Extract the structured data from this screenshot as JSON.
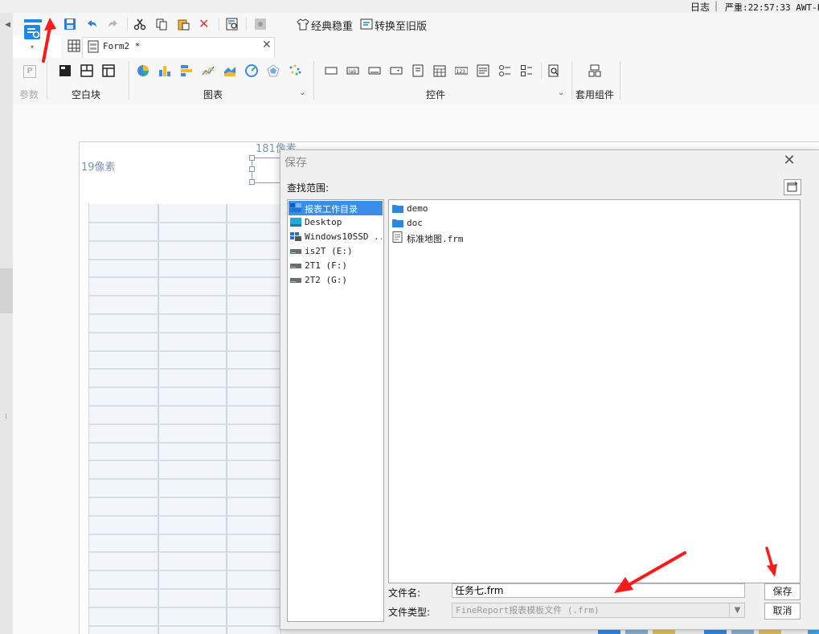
{
  "status_bar": {
    "log_label": "日志",
    "severity_text": "严重:22:57:33 AWT-Ev"
  },
  "toolbar": {
    "classic_stable_label": "经典稳重",
    "convert_old_label": "转换至旧版"
  },
  "tab": {
    "form_name": "Form2 *"
  },
  "ribbon": {
    "params_label": "参数",
    "blank_block_label": "空白块",
    "chart_label": "图表",
    "controls_label": "控件",
    "package_label": "套用组件"
  },
  "canvas": {
    "left_pixel_label": "19像素",
    "top_pixel_label": "181像素"
  },
  "dialog": {
    "title": "保存",
    "look_in_label": "查找范围:",
    "places": [
      "报表工作目录",
      "Desktop",
      "Windows10SSD ...",
      "is2T (E:)",
      "2T1 (F:)",
      "2T2 (G:)"
    ],
    "files": [
      {
        "name": "demo",
        "type": "folder"
      },
      {
        "name": "doc",
        "type": "folder"
      },
      {
        "name": "标准地图.frm",
        "type": "file"
      }
    ],
    "file_name_label": "文件名:",
    "file_name_value": "任务七.frm",
    "file_type_label": "文件类型:",
    "file_type_value": "FineReport报表模板文件 (.frm)",
    "save_button": "保存",
    "cancel_button": "取消"
  },
  "colors": {
    "accent": "#1e88e5",
    "selected": "#3c8de8",
    "arrow_red": "#ff1a1a"
  }
}
